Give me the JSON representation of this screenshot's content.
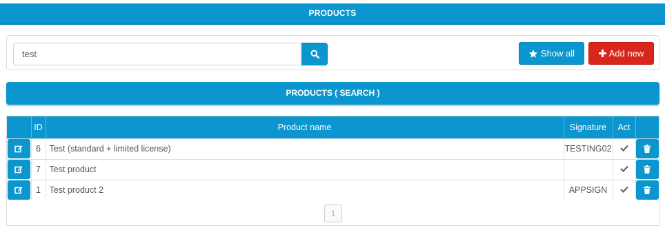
{
  "header": {
    "title": "PRODUCTS"
  },
  "search": {
    "value": "test",
    "icon": "search-icon"
  },
  "toolbar": {
    "show_all_label": "Show all",
    "add_new_label": "Add new"
  },
  "section": {
    "title": "PRODUCTS ( SEARCH )"
  },
  "table": {
    "columns": [
      "",
      "ID",
      "Product name",
      "Signature",
      "Act",
      ""
    ],
    "rows": [
      {
        "id": "6",
        "name": "Test (standard + limited license)",
        "signature": "TESTING02",
        "active": true
      },
      {
        "id": "7",
        "name": "Test product",
        "signature": "",
        "active": true
      },
      {
        "id": "1",
        "name": "Test product 2",
        "signature": "APPSIGN",
        "active": true
      }
    ]
  },
  "pagination": {
    "current_page": "1"
  },
  "colors": {
    "primary": "#0b96cf",
    "danger": "#d9261c",
    "border": "#dcdcdc"
  }
}
